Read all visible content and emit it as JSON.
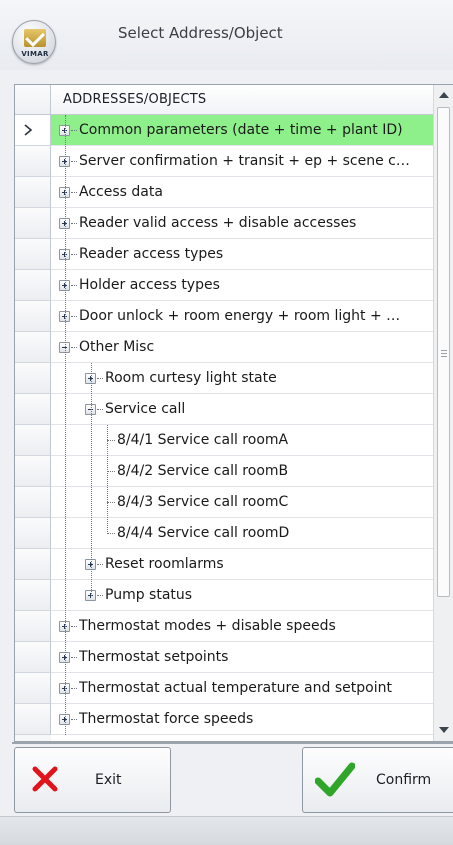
{
  "window": {
    "title": "Select Address/Object",
    "logo_text": "VIMAR"
  },
  "grid": {
    "column_header": "ADDRESSES/OBJECTS",
    "current_row_index": 0,
    "rows": [
      {
        "level": 0,
        "expander": "plus",
        "label": "Common parameters (date + time + plant ID)",
        "selected": true
      },
      {
        "level": 0,
        "expander": "plus",
        "label": "Server confirmation + transit + ep + scene co..."
      },
      {
        "level": 0,
        "expander": "plus",
        "label": "Access data"
      },
      {
        "level": 0,
        "expander": "plus",
        "label": "Reader valid access + disable accesses"
      },
      {
        "level": 0,
        "expander": "plus",
        "label": "Reader access types"
      },
      {
        "level": 0,
        "expander": "plus",
        "label": "Holder access types"
      },
      {
        "level": 0,
        "expander": "plus",
        "label": "Door unlock + room energy + room light + mi..."
      },
      {
        "level": 0,
        "expander": "minus",
        "label": "Other Misc"
      },
      {
        "level": 1,
        "expander": "plus",
        "label": "Room curtesy light state"
      },
      {
        "level": 1,
        "expander": "minus",
        "label": "Service call"
      },
      {
        "level": 2,
        "expander": "none",
        "label": "8/4/1 Service call roomA"
      },
      {
        "level": 2,
        "expander": "none",
        "label": "8/4/2 Service call roomB"
      },
      {
        "level": 2,
        "expander": "none",
        "label": "8/4/3 Service call roomC"
      },
      {
        "level": 2,
        "expander": "none",
        "label": "8/4/4 Service call roomD"
      },
      {
        "level": 1,
        "expander": "plus",
        "label": "Reset roomlarms"
      },
      {
        "level": 1,
        "expander": "plus",
        "label": "Pump status"
      },
      {
        "level": 0,
        "expander": "plus",
        "label": "Thermostat modes + disable speeds"
      },
      {
        "level": 0,
        "expander": "plus",
        "label": "Thermostat setpoints"
      },
      {
        "level": 0,
        "expander": "plus",
        "label": "Thermostat actual temperature and setpoint"
      },
      {
        "level": 0,
        "expander": "plus",
        "label": "Thermostat force speeds"
      }
    ]
  },
  "buttons": {
    "exit_label": "Exit",
    "confirm_label": "Confirm"
  },
  "colors": {
    "selected_row": "#8ef08a",
    "exit_icon": "#e0141a",
    "confirm_icon": "#2fa52a"
  },
  "icons": {
    "exit": "x-icon",
    "confirm": "checkmark-icon",
    "expand": "plus-box-icon",
    "collapse": "minus-box-icon",
    "current_row": "chevron-right-icon"
  }
}
